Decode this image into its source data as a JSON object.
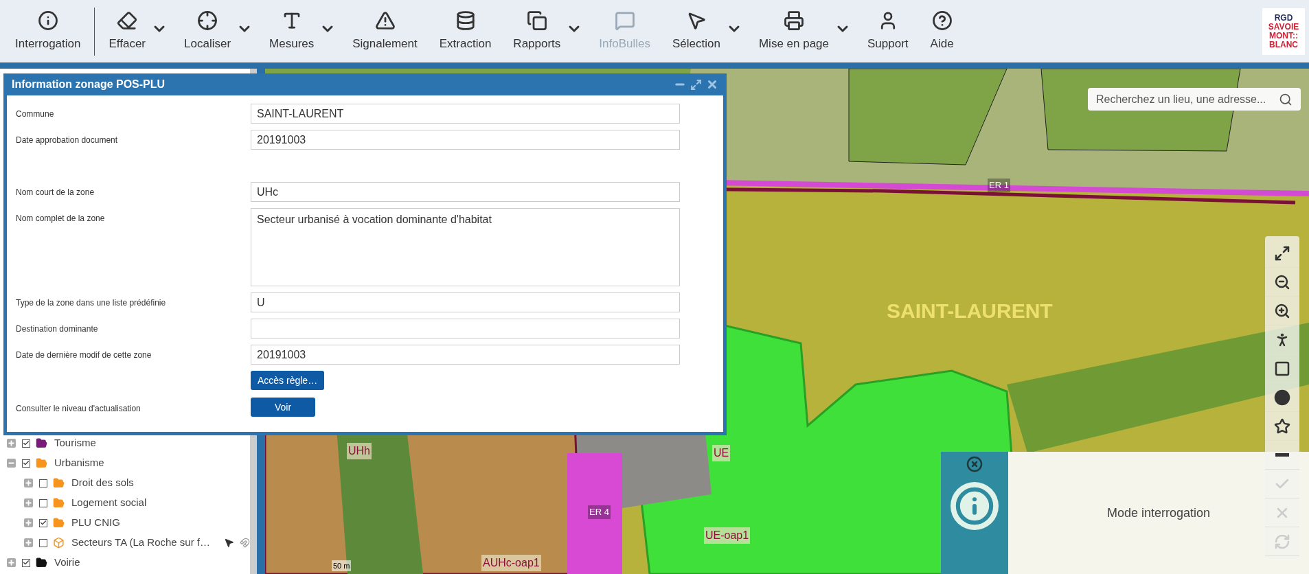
{
  "toolbar": {
    "items": [
      {
        "label": "Interrogation",
        "disabled": false
      },
      {
        "label": "Effacer",
        "disabled": false
      },
      {
        "label": "Localiser",
        "disabled": false
      },
      {
        "label": "Mesures",
        "disabled": false
      },
      {
        "label": "Signalement",
        "disabled": false
      },
      {
        "label": "Extraction",
        "disabled": false
      },
      {
        "label": "Rapports",
        "disabled": false
      },
      {
        "label": "InfoBulles",
        "disabled": true
      },
      {
        "label": "Sélection",
        "disabled": false
      },
      {
        "label": "Mise en page",
        "disabled": false
      },
      {
        "label": "Support",
        "disabled": false
      },
      {
        "label": "Aide",
        "disabled": false
      }
    ],
    "logo": {
      "lines": [
        "RGD",
        "SAVOIE",
        "MONT::",
        "BLANC"
      ]
    }
  },
  "dialog": {
    "title": "Information zonage POS-PLU",
    "rows": [
      {
        "kind": "input",
        "label": "Commune",
        "value": "SAINT-LAURENT"
      },
      {
        "kind": "input",
        "label": "Date approbation document",
        "value": "20191003"
      },
      {
        "kind": "input",
        "label": "Nom court de la zone",
        "value": "UHc"
      },
      {
        "kind": "textarea",
        "label": "Nom complet de la zone",
        "value": "Secteur urbanisé à vocation dominante d'habitat"
      },
      {
        "kind": "input",
        "label": "Type de la zone dans une liste prédéfinie",
        "value": "U"
      },
      {
        "kind": "input",
        "label": "Destination dominante"
      },
      {
        "kind": "input",
        "label": "Date de dernière modif de cette zone",
        "value": "20191003"
      },
      {
        "kind": "button",
        "value": "Accès règle…"
      },
      {
        "kind": "button",
        "label": "Consulter le niveau d'actualisation",
        "value": "Voir"
      }
    ]
  },
  "layer_tree": [
    {
      "kind": "folder",
      "label": "Tourisme",
      "checked": true,
      "expanded": false,
      "color": "#7a1a7a"
    },
    {
      "kind": "folder",
      "label": "Urbanisme",
      "checked": true,
      "expanded": true,
      "color": "#f7941d",
      "children": [
        {
          "kind": "folder",
          "label": "Droit des sols",
          "checked": false,
          "expanded": false,
          "color": "#f7941d"
        },
        {
          "kind": "folder",
          "label": "Logement social",
          "checked": false,
          "expanded": false,
          "color": "#f7941d"
        },
        {
          "kind": "folder",
          "label": "PLU CNIG",
          "checked": true,
          "expanded": false,
          "color": "#f7941d"
        },
        {
          "kind": "layer",
          "label": "Secteurs TA (La Roche sur f…",
          "checked": false,
          "expanded": false,
          "color": "#f7941d"
        }
      ]
    },
    {
      "kind": "folder",
      "label": "Voirie",
      "checked": true,
      "expanded": false,
      "color": "#111111"
    }
  ],
  "map": {
    "search": {
      "placeholder": "Recherchez un lieu, une adresse..."
    },
    "labels": [
      {
        "kind": "small",
        "text": "ER 1"
      },
      {
        "kind": "big",
        "text": "SAINT-LAURENT"
      },
      {
        "kind": "zone",
        "text": "UHh"
      },
      {
        "kind": "zone",
        "text": "UE"
      },
      {
        "kind": "small",
        "text": "ER 4"
      },
      {
        "kind": "zone",
        "text": "UE-oap1"
      },
      {
        "kind": "zone",
        "text": "AUHc-oap1"
      }
    ],
    "scale": "50 m",
    "tools": [
      {
        "disabled": false
      },
      {
        "disabled": false
      },
      {
        "disabled": false
      },
      {
        "disabled": false
      },
      {
        "disabled": false
      },
      {
        "disabled": false
      },
      {
        "disabled": false
      },
      {
        "disabled": false
      },
      {
        "disabled": true
      },
      {
        "disabled": true
      },
      {
        "disabled": true
      }
    ]
  },
  "notification": {
    "text": "Mode interrogation"
  }
}
